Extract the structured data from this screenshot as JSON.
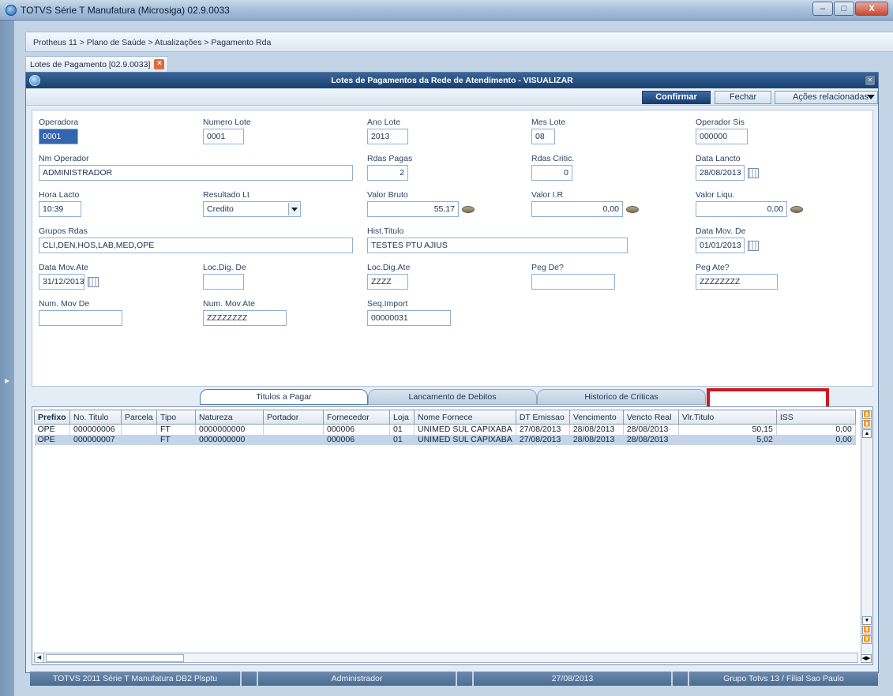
{
  "window": {
    "title": "TOTVS Série T Manufatura (Microsiga) 02.9.0033",
    "buttons": {
      "minimize": "–",
      "maximize": "□",
      "close": "X"
    }
  },
  "breadcrumb": "Protheus 11 > Plano de Saúde > Atualizações > Pagamento Rda",
  "doc_tab": {
    "label": "Lotes de Pagamento [02.9.0033]",
    "close": "×"
  },
  "dialog": {
    "title": "Lotes de Pagamentos da Rede de Atendimento - VISUALIZAR",
    "close": "×",
    "buttons": {
      "confirm": "Confirmar",
      "close": "Fechar",
      "actions": "Ações relacionadas"
    }
  },
  "form": {
    "operadora": {
      "label": "Operadora",
      "value": "0001"
    },
    "numero_lote": {
      "label": "Numero Lote",
      "value": "0001"
    },
    "ano_lote": {
      "label": "Ano Lote",
      "value": "2013"
    },
    "mes_lote": {
      "label": "Mes Lote",
      "value": "08"
    },
    "operador_sis": {
      "label": "Operador Sis",
      "value": "000000"
    },
    "nm_operador": {
      "label": "Nm Operador",
      "value": "ADMINISTRADOR"
    },
    "rdas_pagas": {
      "label": "Rdas Pagas",
      "value": "2"
    },
    "rdas_critic": {
      "label": "Rdas Critic.",
      "value": "0"
    },
    "data_lancto": {
      "label": "Data Lancto",
      "value": "28/08/2013"
    },
    "hora_lacto": {
      "label": "Hora Lacto",
      "value": "10:39"
    },
    "resultado_lt": {
      "label": "Resultado Lt",
      "value": "Credito"
    },
    "valor_bruto": {
      "label": "Valor Bruto",
      "value": "55,17"
    },
    "valor_ir": {
      "label": "Valor I.R",
      "value": "0,00"
    },
    "valor_liqu": {
      "label": "Valor Liqu.",
      "value": "0,00"
    },
    "grupos_rdas": {
      "label": "Grupos Rdas",
      "value": "CLI,DEN,HOS,LAB,MED,OPE"
    },
    "hist_titulo": {
      "label": "Hist.Titulo",
      "value": "TESTES PTU AJIUS"
    },
    "data_mov_de": {
      "label": "Data Mov. De",
      "value": "01/01/2013"
    },
    "data_mov_ate": {
      "label": "Data Mov.Ate",
      "value": "31/12/2013"
    },
    "loc_dig_de": {
      "label": "Loc.Dig. De",
      "value": ""
    },
    "loc_dig_ate": {
      "label": "Loc.Dig.Ate",
      "value": "ZZZZ"
    },
    "peg_de": {
      "label": "Peg De?",
      "value": ""
    },
    "peg_ate": {
      "label": "Peg Ate?",
      "value": "ZZZZZZZZ"
    },
    "num_mov_de": {
      "label": "Num. Mov De",
      "value": ""
    },
    "num_mov_ate": {
      "label": "Num. Mov Ate",
      "value": "ZZZZZZZZ"
    },
    "seq_import": {
      "label": "Seq.Import",
      "value": "00000031"
    }
  },
  "tabs": [
    "Titulos a Pagar",
    "Lancamento de Debitos",
    "Historico de Criticas"
  ],
  "grid": {
    "columns": [
      "Prefixo",
      "No. Titulo",
      "Parcela",
      "Tipo",
      "Natureza",
      "Portador",
      "Fornecedor",
      "Loja",
      "Nome Fornece",
      "DT Emissao",
      "Vencimento",
      "Vencto Real",
      "Vlr.Titulo",
      "ISS"
    ],
    "rows": [
      [
        "OPE",
        "000000006",
        "",
        "FT",
        "0000000000",
        "",
        "000006",
        "01",
        "UNIMED SUL CAPIXABA",
        "27/08/2013",
        "28/08/2013",
        "28/08/2013",
        "50,15",
        "0,00"
      ],
      [
        "OPE",
        "000000007",
        "",
        "FT",
        "0000000000",
        "",
        "000006",
        "01",
        "UNIMED SUL CAPIXABA",
        "27/08/2013",
        "28/08/2013",
        "28/08/2013",
        "5,02",
        "0,00"
      ]
    ],
    "selected_row": 1
  },
  "statusbar": [
    "TOTVS 2011 Série T Manufatura DB2 Plsptu",
    "",
    "Administrador",
    "",
    "27/08/2013",
    "",
    "Grupo Totvs 13 / Filial Sao Paulo"
  ],
  "colors": {
    "highlight_box": "#d01820",
    "accent": "#16406f"
  }
}
